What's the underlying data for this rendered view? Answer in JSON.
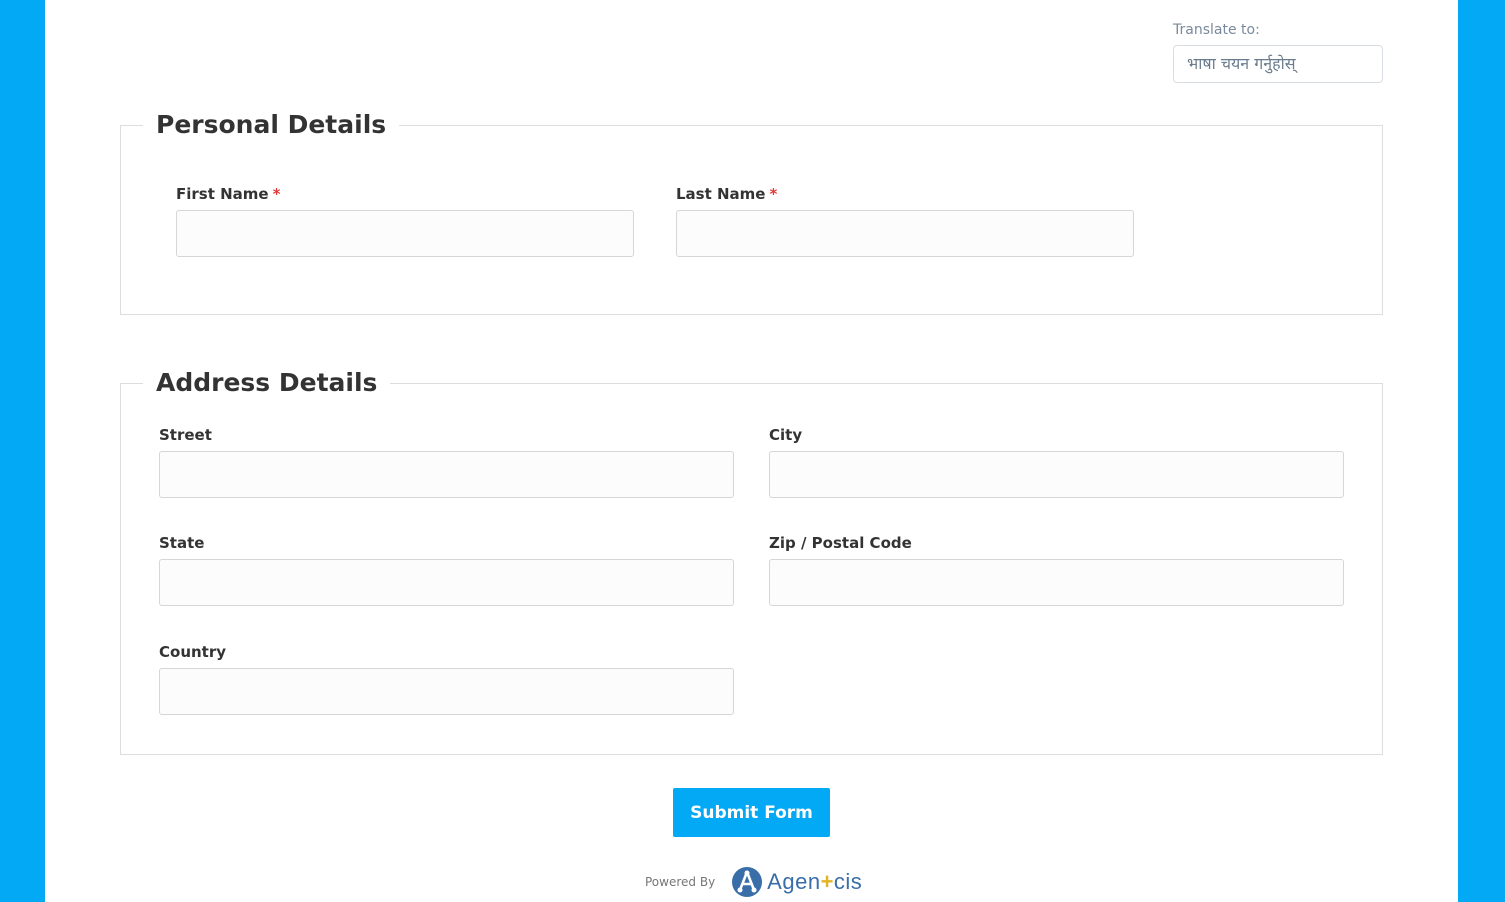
{
  "colors": {
    "background": "#03a9f4",
    "accent": "#03a9f4",
    "required": "#e53935",
    "brand": "#3a6ea8",
    "brand_plus": "#e3b325"
  },
  "translate": {
    "label": "Translate to:",
    "selected": "भाषा चयन गर्नुहोस्"
  },
  "personal": {
    "legend": "Personal Details",
    "first_name": {
      "label": "First Name",
      "required_mark": "*",
      "value": ""
    },
    "last_name": {
      "label": "Last Name",
      "required_mark": "*",
      "value": ""
    }
  },
  "address": {
    "legend": "Address Details",
    "street": {
      "label": "Street",
      "value": ""
    },
    "city": {
      "label": "City",
      "value": ""
    },
    "state": {
      "label": "State",
      "value": ""
    },
    "zip": {
      "label": "Zip / Postal Code",
      "value": ""
    },
    "country": {
      "label": "Country",
      "value": ""
    }
  },
  "submit": {
    "label": "Submit Form"
  },
  "footer": {
    "powered_by": "Powered By",
    "brand_before": "Agen",
    "brand_plus": "+",
    "brand_after": "cis",
    "brand_icon": "agencis-logo-icon"
  }
}
